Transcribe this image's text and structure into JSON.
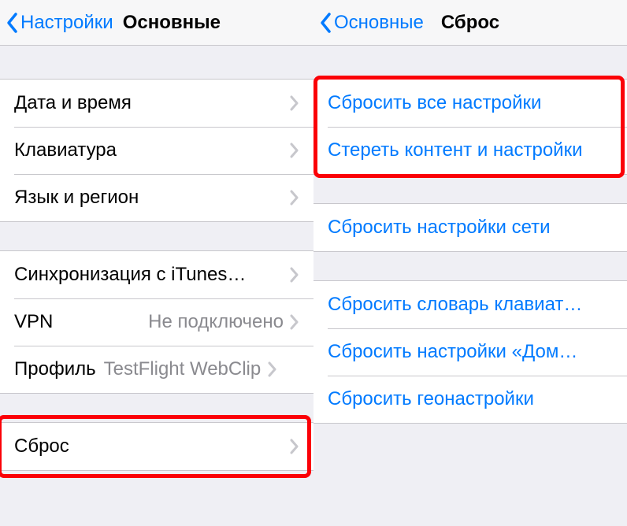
{
  "left": {
    "back": "Настройки",
    "title": "Основные",
    "group1": [
      {
        "label": "Дата и время"
      },
      {
        "label": "Клавиатура"
      },
      {
        "label": "Язык и регион"
      }
    ],
    "group2": [
      {
        "label": "Синхронизация с iTunes…"
      },
      {
        "label": "VPN",
        "value": "Не подключено"
      },
      {
        "label": "Профиль",
        "value": "TestFlight WebClip"
      }
    ],
    "group3": [
      {
        "label": "Сброс"
      }
    ]
  },
  "right": {
    "back": "Основные",
    "title": "Сброс",
    "group1": [
      {
        "label": "Сбросить все настройки"
      },
      {
        "label": "Стереть контент и настройки"
      }
    ],
    "group2": [
      {
        "label": "Сбросить настройки сети"
      }
    ],
    "group3": [
      {
        "label": "Сбросить словарь клавиат…"
      },
      {
        "label": "Сбросить настройки «Дом…"
      },
      {
        "label": "Сбросить геонастройки"
      }
    ]
  }
}
